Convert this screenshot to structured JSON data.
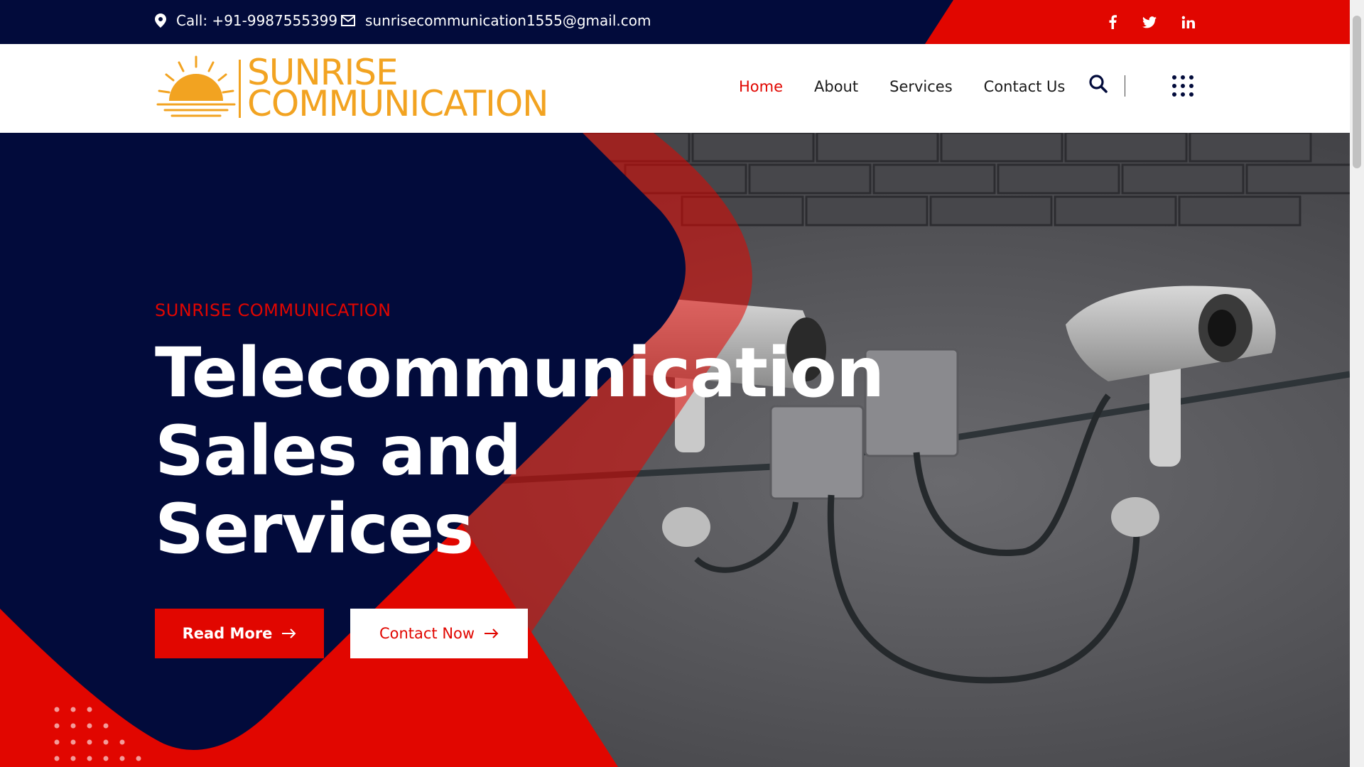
{
  "topbar": {
    "phone": "Call: +91-9987555399",
    "email": "sunrisecommunication1555@gmail.com",
    "social": [
      {
        "name": "facebook",
        "glyph": "f"
      },
      {
        "name": "twitter",
        "glyph": "t"
      },
      {
        "name": "linkedin",
        "glyph": "in"
      }
    ]
  },
  "brand": {
    "line1": "SUNRISE",
    "line2": "COMMUNICATION"
  },
  "nav": {
    "items": [
      "Home",
      "About",
      "Services",
      "Contact Us"
    ],
    "active": "Home"
  },
  "hero": {
    "eyebrow": "SUNRISE COMMUNICATION",
    "title_line1": "Telecommunication",
    "title_line2": "Sales and",
    "title_line3": "Services",
    "primary_button": "Read More",
    "secondary_button": "Contact Now"
  },
  "icons": {
    "location": "location-pin-icon",
    "email": "envelope-icon",
    "search": "search-icon",
    "menu": "grid-menu-icon",
    "arrow": "arrow-right-icon"
  },
  "colors": {
    "navy": "#020b3b",
    "red": "#e10600",
    "brand_orange": "#f2a321",
    "white": "#ffffff"
  }
}
